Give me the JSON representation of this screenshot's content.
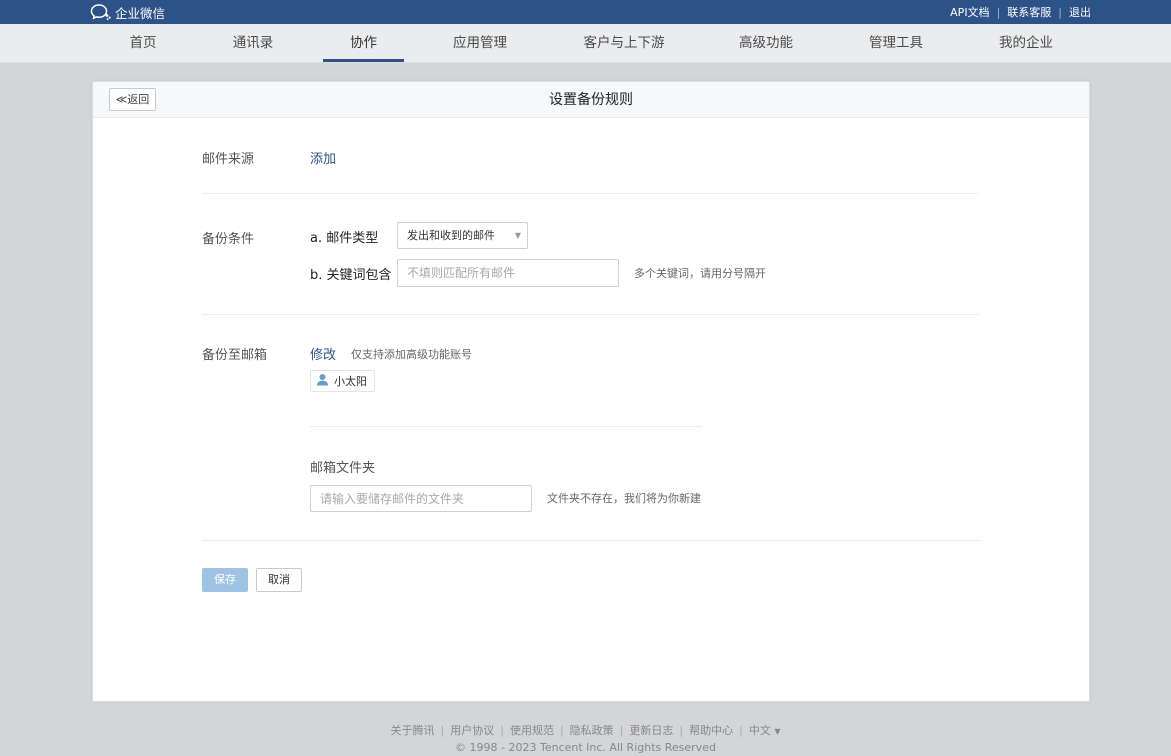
{
  "header": {
    "brand": "企业微信",
    "links": [
      "API文档",
      "联系客服",
      "退出"
    ]
  },
  "nav": {
    "items": [
      "首页",
      "通讯录",
      "协作",
      "应用管理",
      "客户与上下游",
      "高级功能",
      "管理工具",
      "我的企业"
    ],
    "active_index": 2
  },
  "panel": {
    "back_label": "≪返回",
    "title": "设置备份规则"
  },
  "form": {
    "source": {
      "label": "邮件来源",
      "action": "添加"
    },
    "condition": {
      "label": "备份条件",
      "type_label": "a. 邮件类型",
      "type_value": "发出和收到的邮件",
      "keyword_label": "b. 关键词包含",
      "keyword_placeholder": "不填则匹配所有邮件",
      "keyword_hint": "多个关键词，请用分号隔开"
    },
    "mailbox": {
      "label": "备份至邮箱",
      "action": "修改",
      "hint": "仅支持添加高级功能账号",
      "member": "小太阳",
      "folder_label": "邮箱文件夹",
      "folder_placeholder": "请输入要储存邮件的文件夹",
      "folder_hint": "文件夹不存在，我们将为你新建"
    },
    "save_label": "保存",
    "cancel_label": "取消"
  },
  "footer": {
    "links": [
      "关于腾讯",
      "用户协议",
      "使用规范",
      "隐私政策",
      "更新日志",
      "帮助中心"
    ],
    "language": "中文",
    "copyright": "© 1998 - 2023 Tencent Inc. All Rights Reserved"
  },
  "colors": {
    "brand_blue": "#2d5287",
    "save_button": "#9ec3e3",
    "page_background": "#d3d5d8"
  }
}
